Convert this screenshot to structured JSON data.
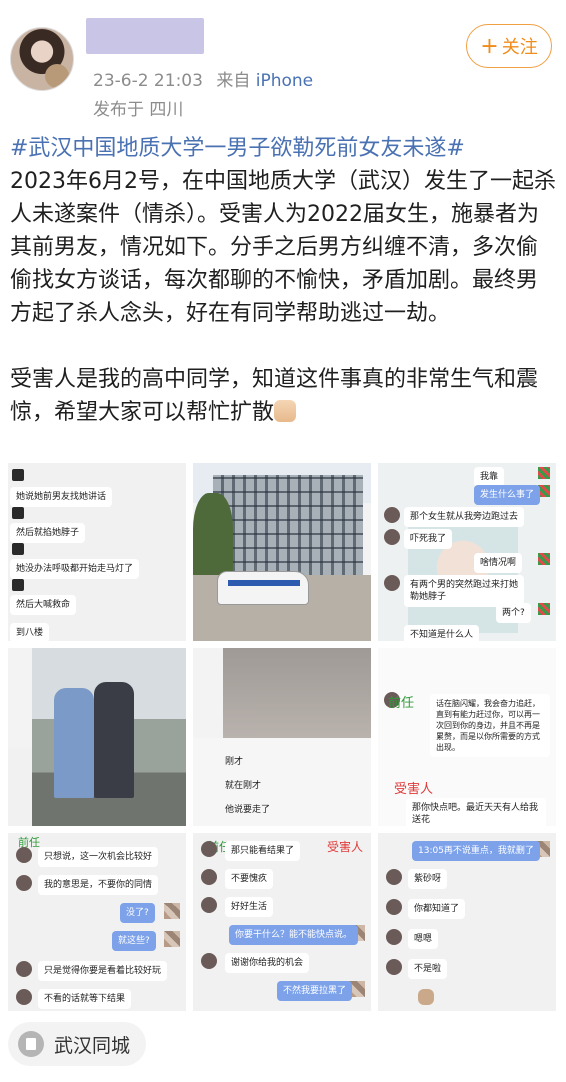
{
  "header": {
    "timestamp": "23-6-2 21:03",
    "source_prefix": "来自",
    "source_device": "iPhone",
    "location": "发布于 四川",
    "follow_label": "关注",
    "follow_plus": "+"
  },
  "post": {
    "topic": "#武汉中国地质大学一男子欲勒死前女友未遂#",
    "paragraph1": "2023年6月2号，在中国地质大学（武汉）发生了一起杀人未遂案件（情杀）。受害人为2022届女生，施暴者为其前男友，情况如下。分手之后男方纠缠不清，多次偷偷找女方谈话，每次都聊的不愉快，矛盾加剧。最终男方起了杀人念头，好在有同学帮助逃过一劫。",
    "paragraph2": "受害人是我的高中同学，知道这件事真的非常生气和震惊，希望大家可以帮忙扩散"
  },
  "images": {
    "c1": [
      "她说她前男友找她讲话",
      "然后就掐她脖子",
      "她没办法呼吸都开始走马灯了",
      "然后大喊救命",
      "到八楼"
    ],
    "c3": [
      "我靠",
      "发生什么事了",
      "那个女生就从我旁边跑过去",
      "吓死我了",
      "啥情况啊",
      "有两个男的突然跑过来打她勒她脖子",
      "两个?",
      "不知道是什么人"
    ],
    "c5": [
      "刚才",
      "就在刚才",
      "他说要走了"
    ],
    "c6_name": "前任",
    "c6": [
      "话在脑闪耀，我会奋力追赶，直到有能力赶过你，可以再一次回到你的身边，并且不再是累赘，而是以你所需要的方式出现。",
      "受害人",
      "那你快点吧。最近天天有人给我送花"
    ],
    "c7_name": "前任",
    "c7": [
      "只想说，这一次机会比较好",
      "我的意思是，不要你的同情",
      "没了?",
      "就这些?",
      "只是觉得你要是看着比较好玩",
      "不看的话就等下结果"
    ],
    "c8_name": "前任",
    "c8_label": "受害人",
    "c8": [
      "那只能看结果了",
      "不要愧疚",
      "好好生活",
      "你要干什么？能不能快点说。",
      "谢谢你给我的机会",
      "不然我要拉黑了"
    ],
    "c9": [
      "13:05再不说重点，我就删了",
      "紫砂呀",
      "你都知道了",
      "嗯嗯",
      "不是啦"
    ]
  },
  "footer": {
    "city_tag": "武汉同城"
  },
  "colors": {
    "link_blue": "#4a72b3",
    "follow_orange": "#f08c1a",
    "meta_gray": "#8c8c8c"
  }
}
